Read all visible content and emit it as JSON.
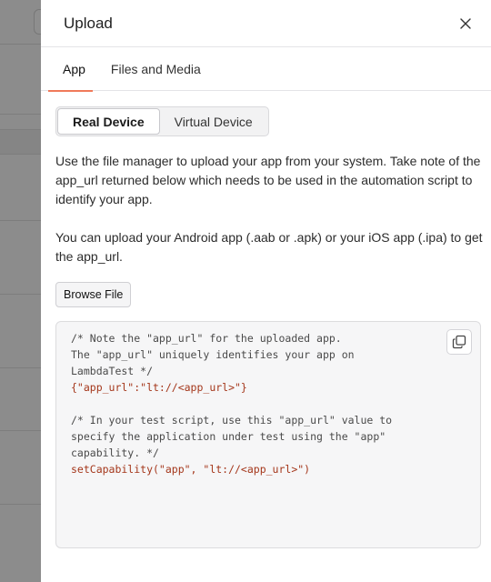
{
  "drawer": {
    "title": "Upload",
    "close_icon": "close-icon"
  },
  "tabs": [
    {
      "label": "App",
      "active": true
    },
    {
      "label": "Files and Media",
      "active": false
    }
  ],
  "device_toggle": {
    "options": [
      "Real Device",
      "Virtual Device"
    ],
    "selected": "Real Device"
  },
  "description": {
    "p1": "Use the file manager to upload your app from your system. Take note of the app_url returned below which needs to be used in the automation script to identify your app.",
    "p2": "You can upload your Android app (.aab or .apk) or your iOS app (.ipa) to get the app_url."
  },
  "browse_label": "Browse File",
  "code": {
    "lines": [
      "/* Note the \"app_url\" for the uploaded app.",
      "The \"app_url\" uniquely identifies your app on",
      "LambdaTest */",
      "{\"app_url\":\"lt://<app_url>\"}",
      "",
      "/* In your test script, use this \"app_url\" value to",
      "specify the application under test using the \"app\"",
      "capability. */",
      "setCapability(\"app\", \"lt://<app_url>\")"
    ],
    "copy_icon": "copy-icon"
  },
  "colors": {
    "accent": "#f07a5a",
    "code_literal": "#a4361a",
    "overlay": "#8a8a8a"
  }
}
